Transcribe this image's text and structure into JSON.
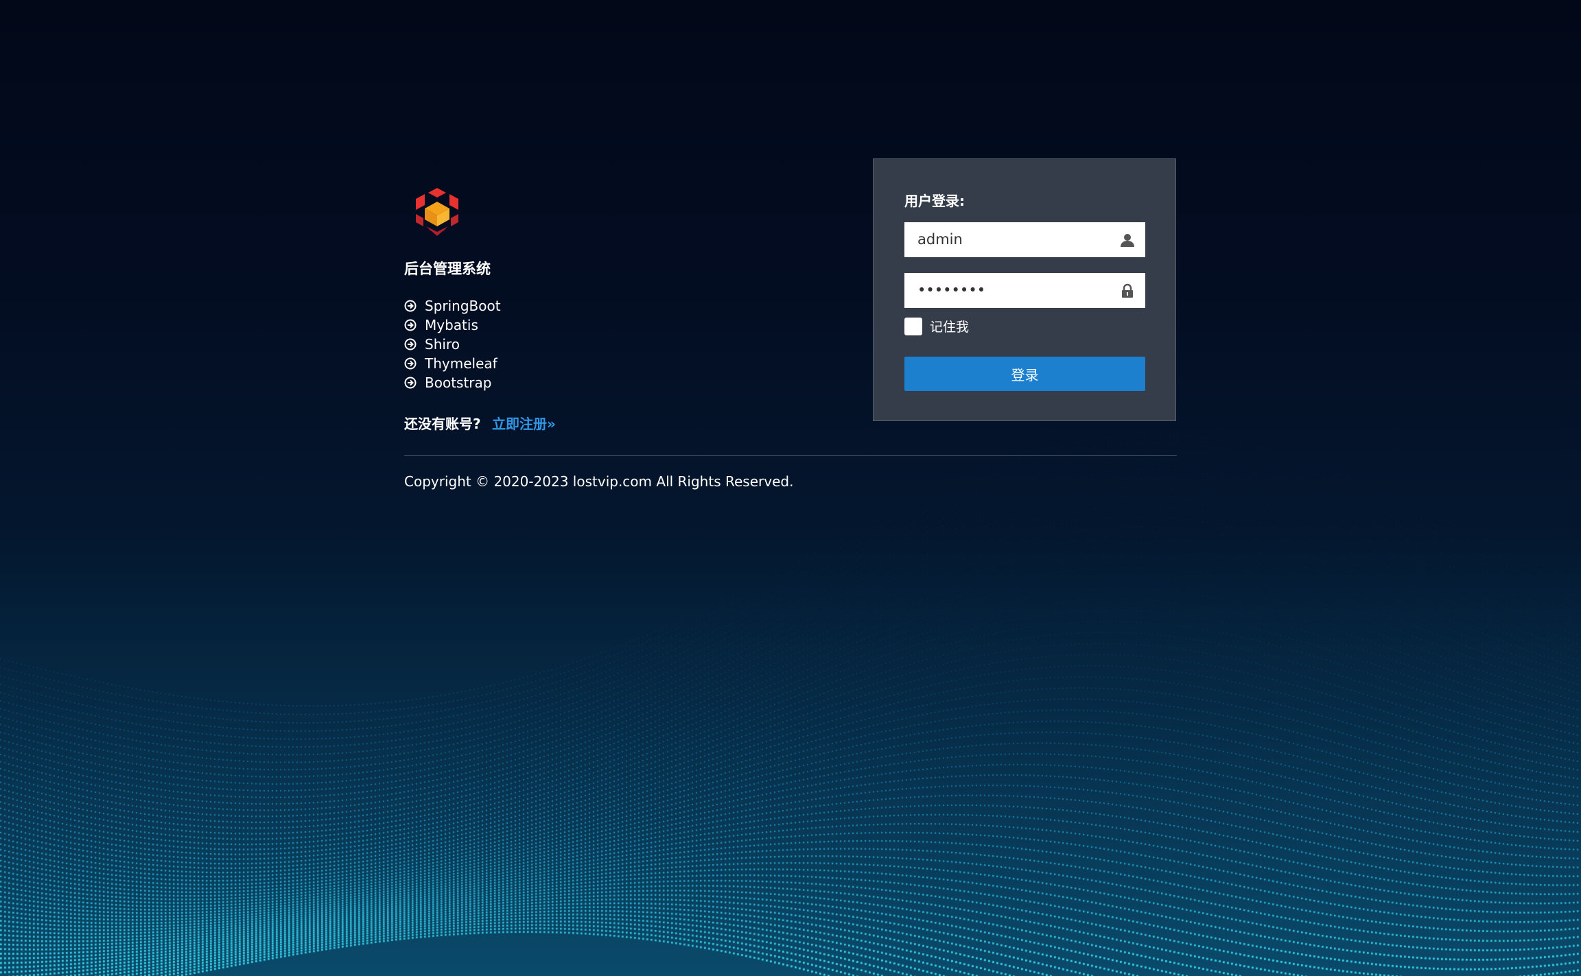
{
  "brand": {
    "system_title": "后台管理系统",
    "logo_icon": "cube-logo-icon",
    "logo_colors": [
      "#e8322f",
      "#f5a21b",
      "#b51d2f"
    ]
  },
  "features": [
    {
      "label": "SpringBoot",
      "icon": "circle-arrow-right-icon"
    },
    {
      "label": "Mybatis",
      "icon": "circle-arrow-right-icon"
    },
    {
      "label": "Shiro",
      "icon": "circle-arrow-right-icon"
    },
    {
      "label": "Thymeleaf",
      "icon": "circle-arrow-right-icon"
    },
    {
      "label": "Bootstrap",
      "icon": "circle-arrow-right-icon"
    }
  ],
  "register": {
    "question": "还没有账号?",
    "link_label": "立即注册»"
  },
  "footer": {
    "copyright": "Copyright © 2020-2023 lostvip.com All Rights Reserved."
  },
  "login": {
    "title": "用户登录:",
    "username_value": "admin",
    "username_icon": "user-icon",
    "password_value": "••••••••",
    "password_icon": "lock-icon",
    "remember_label": "记住我",
    "remember_checked": false,
    "submit_label": "登录"
  },
  "colors": {
    "accent": "#1c80cf",
    "link": "#2f97e6",
    "panel": "#353c4a",
    "wave": "#19c6ee"
  }
}
